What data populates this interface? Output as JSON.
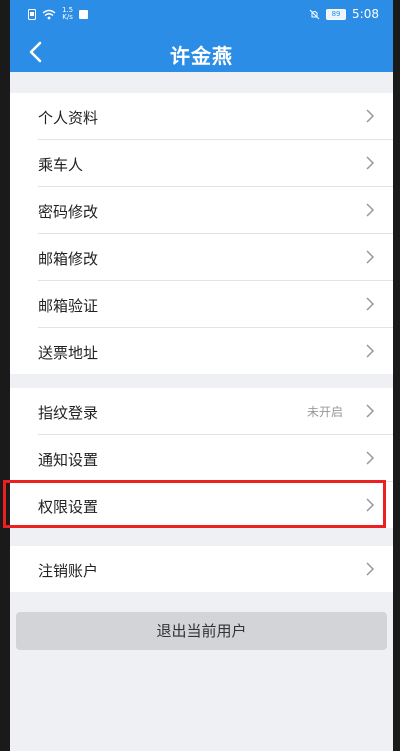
{
  "status_bar": {
    "speed_value": "1.5",
    "speed_unit": "K/s",
    "battery": "89",
    "time": "5:08"
  },
  "header": {
    "title": "许金燕",
    "back_icon": "chevron-left-icon"
  },
  "groups": [
    {
      "items": [
        {
          "label": "个人资料",
          "icon": "chevron-right-icon"
        },
        {
          "label": "乘车人",
          "icon": "chevron-right-icon"
        },
        {
          "label": "密码修改",
          "icon": "chevron-right-icon"
        },
        {
          "label": "邮箱修改",
          "icon": "chevron-right-icon"
        },
        {
          "label": "邮箱验证",
          "icon": "chevron-right-icon"
        },
        {
          "label": "送票地址",
          "icon": "chevron-right-icon"
        }
      ]
    },
    {
      "items": [
        {
          "label": "指纹登录",
          "value": "未开启",
          "icon": "chevron-right-icon"
        },
        {
          "label": "通知设置",
          "icon": "chevron-right-icon"
        },
        {
          "label": "权限设置",
          "icon": "chevron-right-icon",
          "highlighted": true
        }
      ]
    },
    {
      "items": [
        {
          "label": "注销账户",
          "icon": "chevron-right-icon"
        }
      ]
    }
  ],
  "logout_button": {
    "label": "退出当前用户"
  },
  "colors": {
    "accent": "#2b8de6",
    "highlight_border": "#ee1f1f",
    "background": "#eef0f4"
  }
}
